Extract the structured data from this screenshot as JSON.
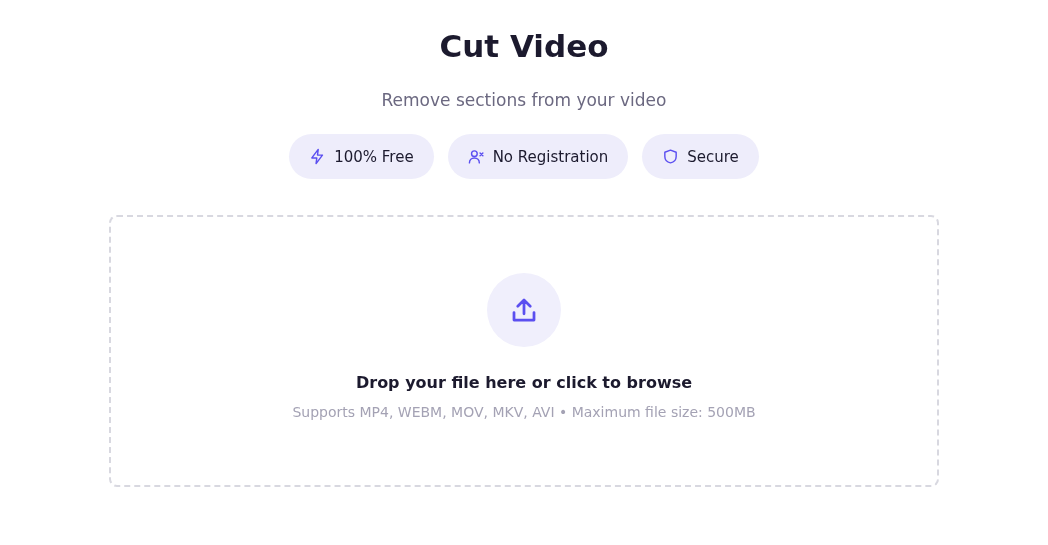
{
  "title": "Cut Video",
  "subtitle": "Remove sections from your video",
  "badges": [
    {
      "kind": "bolt",
      "label": "100% Free"
    },
    {
      "kind": "user-x",
      "label": "No Registration"
    },
    {
      "kind": "shield",
      "label": "Secure"
    }
  ],
  "dropzone": {
    "prompt": "Drop your file here or click to browse",
    "hint": "Supports MP4, WEBM, MOV, MKV, AVI • Maximum file size: 500MB"
  }
}
